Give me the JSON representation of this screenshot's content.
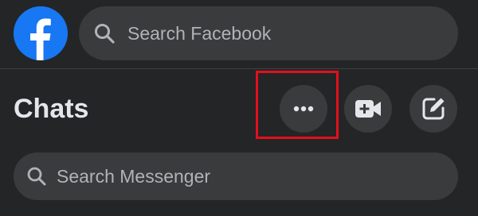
{
  "topbar": {
    "logo_icon": "facebook-logo-icon",
    "search": {
      "icon": "search-icon",
      "placeholder": "Search Facebook"
    }
  },
  "chats": {
    "title": "Chats",
    "actions": [
      {
        "name": "options",
        "icon": "more-options-icon"
      },
      {
        "name": "video",
        "icon": "video-camera-plus-icon"
      },
      {
        "name": "compose",
        "icon": "compose-edit-icon"
      }
    ],
    "highlight_color": "#e3101d"
  },
  "messenger_search": {
    "icon": "search-icon",
    "placeholder": "Search Messenger"
  },
  "colors": {
    "background": "#242526",
    "surface": "#3a3b3c",
    "brand": "#1877f2",
    "text_primary": "#e4e6eb",
    "text_secondary": "#b0b3b8"
  }
}
